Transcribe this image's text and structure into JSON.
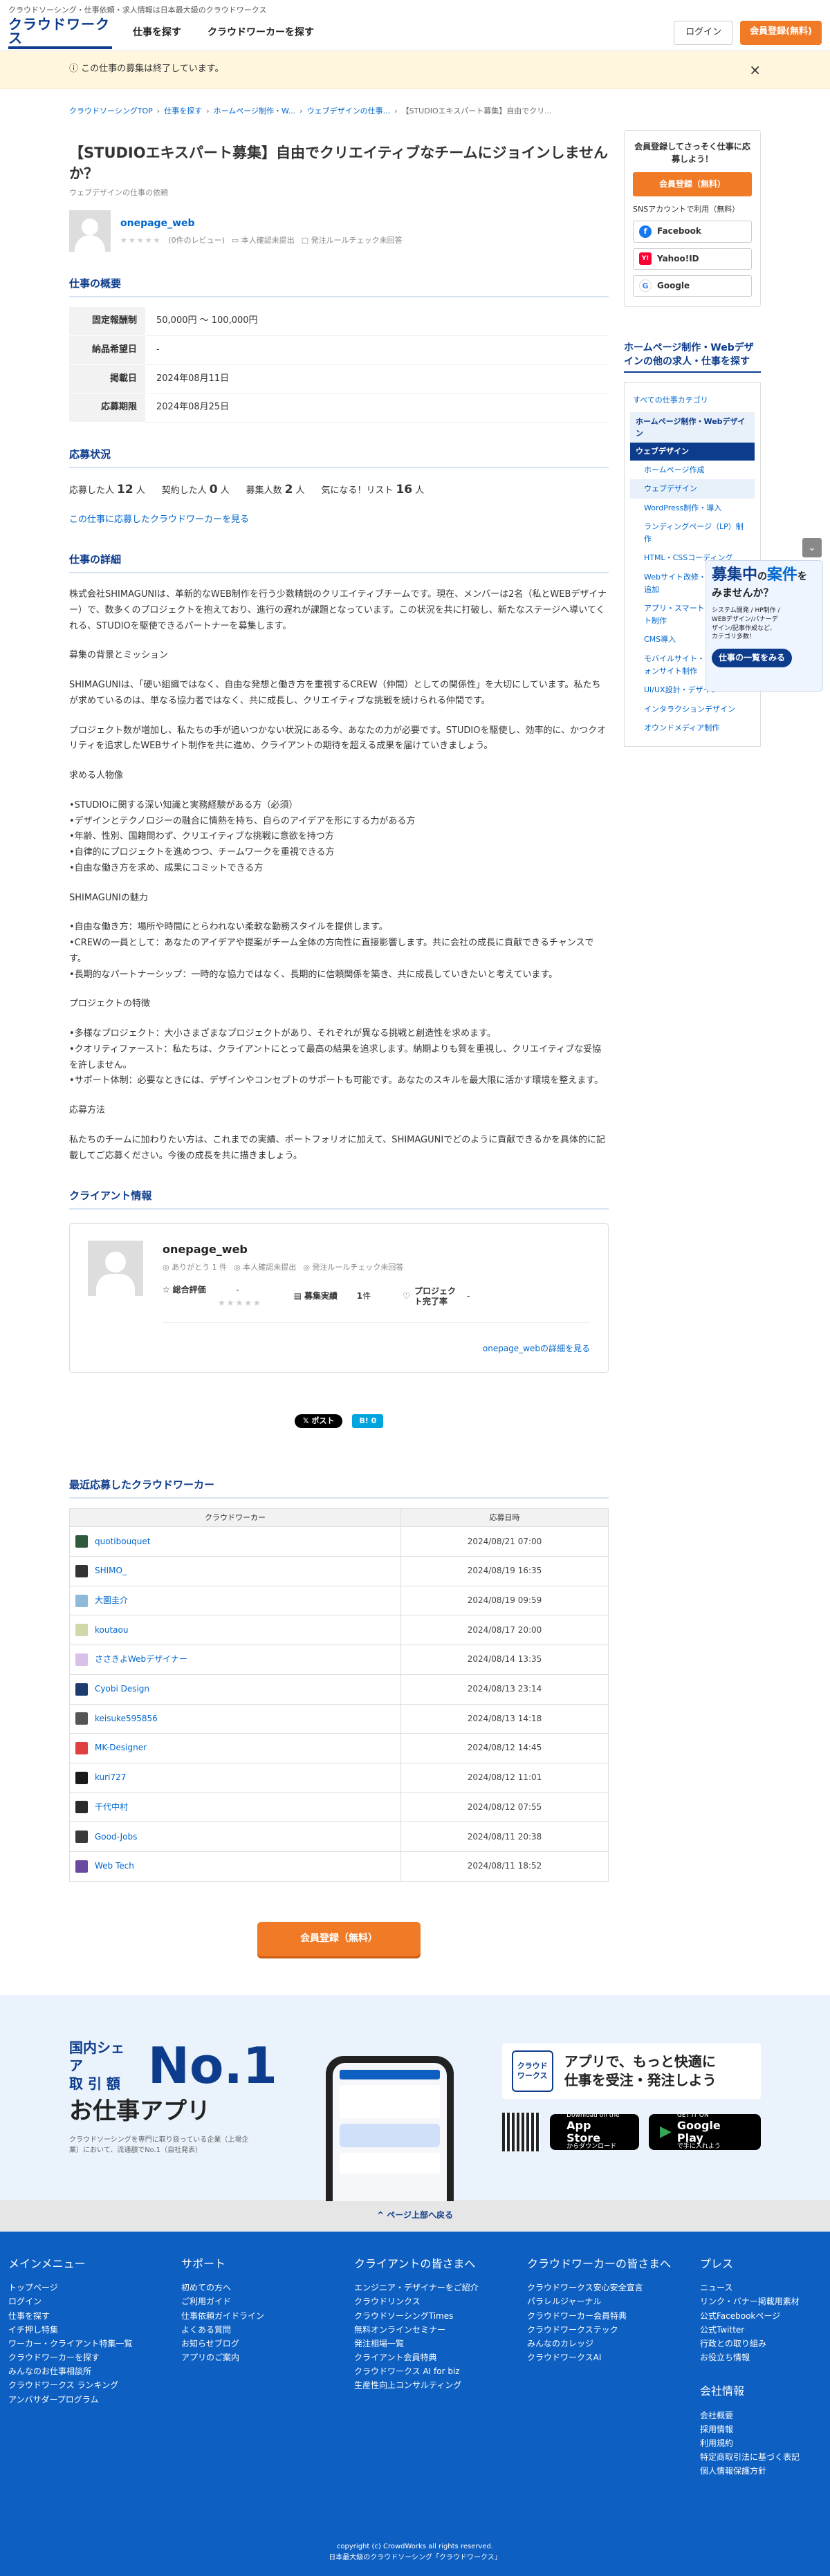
{
  "tagline": "クラウドソーシング・仕事依頼・求人情報は日本最大級のクラウドワークス",
  "header": {
    "logo_text": "クラウドワークス",
    "nav": [
      "仕事を探す",
      "クラウドワーカーを探す"
    ],
    "login": "ログイン",
    "signup": "会員登録(無料)"
  },
  "notice": {
    "text": "この仕事の募集は終了しています。",
    "close": "×"
  },
  "breadcrumb": [
    "クラウドソーシングTOP",
    "仕事を探す",
    "ホームページ制作・W...",
    "ウェブデザインの仕事...",
    "【STUDIOエキスパート募集】自由でクリ..."
  ],
  "job": {
    "title": "【STUDIOエキスパート募集】自由でクリエイティブなチームにジョインしませんか？",
    "subtitle": "ウェブデザインの仕事の依頼",
    "client_name": "onepage_web",
    "stars": "★★★★★",
    "reviews": "(0件のレビュー)",
    "identity": "本人確認未提出",
    "rule_check": "発注ルールチェック未回答"
  },
  "summary": {
    "heading": "仕事の概要",
    "rows": [
      {
        "label": "固定報酬制",
        "value": "50,000円 〜 100,000円"
      },
      {
        "label": "納品希望日",
        "value": "-"
      },
      {
        "label": "掲載日",
        "value": "2024年08月11日"
      },
      {
        "label": "応募期限",
        "value": "2024年08月25日"
      }
    ]
  },
  "status": {
    "heading": "応募状況",
    "applicants_label": "応募した人",
    "applicants": "12",
    "contracted_label": "契約した人",
    "contracted": "0",
    "quota_label": "募集人数",
    "quota": "2",
    "watch_label": "気になる！リスト",
    "watch": "16",
    "unit_person": "人",
    "link": "この仕事に応募したクラウドワーカーを見る"
  },
  "detail": {
    "heading": "仕事の詳細",
    "paragraphs": [
      "株式会社SHIMAGUNIは、革新的なWEB制作を行う少数精鋭のクリエイティブチームです。現在、メンバーは2名（私とWEBデザイナー）で、数多くのプロジェクトを抱えており、進行の遅れが課題となっています。この状況を共に打破し、新たなステージへ導いてくれる、STUDIOを駆使できるパートナーを募集します。",
      "募集の背景とミッション",
      "SHIMAGUNIは、「硬い組織ではなく、自由な発想と働き方を重視するCREW（仲間）としての関係性」を大切にしています。私たちが求めているのは、単なる協力者ではなく、共に成長し、クリエイティブな挑戦を続けられる仲間です。",
      "プロジェクト数が増加し、私たちの手が追いつかない状況にある今、あなたの力が必要です。STUDIOを駆使し、効率的に、かつクオリティを追求したWEBサイト制作を共に進め、クライアントの期待を超える成果を届けていきましょう。",
      "求める人物像",
      "•STUDIOに関する深い知識と実務経験がある方（必須）\n•デザインとテクノロジーの融合に情熱を持ち、自らのアイデアを形にする力がある方\n•年齢、性別、国籍問わず、クリエイティブな挑戦に意欲を持つ方\n•自律的にプロジェクトを進めつつ、チームワークを重視できる方\n•自由な働き方を求め、成果にコミットできる方",
      "SHIMAGUNIの魅力",
      "•自由な働き方：場所や時間にとらわれない柔軟な勤務スタイルを提供します。\n•CREWの一員として：あなたのアイデアや提案がチーム全体の方向性に直接影響します。共に会社の成長に貢献できるチャンスです。\n•長期的なパートナーシップ：一時的な協力ではなく、長期的に信頼関係を築き、共に成長していきたいと考えています。",
      "プロジェクトの特徴",
      "•多様なプロジェクト：大小さまざまなプロジェクトがあり、それぞれが異なる挑戦と創造性を求めます。\n•クオリティファースト：私たちは、クライアントにとって最高の結果を追求します。納期よりも質を重視し、クリエイティブな妥協を許しません。\n•サポート体制：必要なときには、デザインやコンセプトのサポートも可能です。あなたのスキルを最大限に活かす環境を整えます。",
      "応募方法",
      "私たちのチームに加わりたい方は、これまでの実績、ポートフォリオに加えて、SHIMAGUNIでどのように貢献できるかを具体的に記載してご応募ください。今後の成長を共に描きましょう。"
    ]
  },
  "client_info": {
    "heading": "クライアント情報",
    "name": "onepage_web",
    "thanks": "ありがとう 1 件",
    "identity": "本人確認未提出",
    "rule_check": "発注ルールチェック未回答",
    "rating_label": "総合評価",
    "rating_value": "-",
    "stars": "★★★★★",
    "record_label": "募集実績",
    "record_value": "1",
    "record_unit": "件",
    "completion_label": "プロジェクト完了率",
    "completion_value": "-",
    "detail_link": "onepage_webの詳細を見る"
  },
  "share": {
    "x": "𝕏 ポスト",
    "hatena": "B! 0"
  },
  "workers": {
    "heading": "最近応募したクラウドワーカー",
    "col_worker": "クラウドワーカー",
    "col_date": "応募日時",
    "rows": [
      {
        "name": "quotibouquet",
        "date": "2024/08/21 07:00",
        "color": "#2e5a3e"
      },
      {
        "name": "SHIMO_",
        "date": "2024/08/19 16:35",
        "color": "#333333"
      },
      {
        "name": "大園圭介",
        "date": "2024/08/19 09:59",
        "color": "#8fb9d8"
      },
      {
        "name": "koutaou",
        "date": "2024/08/17 20:00",
        "color": "#cfd8a8"
      },
      {
        "name": "ささきよWebデザイナー",
        "date": "2024/08/14 13:35",
        "color": "#d8c0e8"
      },
      {
        "name": "Cyobi Design",
        "date": "2024/08/13 23:14",
        "color": "#1d3b6e"
      },
      {
        "name": "keisuke595856",
        "date": "2024/08/13 14:18",
        "color": "#555555"
      },
      {
        "name": "MK-Designer",
        "date": "2024/08/12 14:45",
        "color": "#e04040"
      },
      {
        "name": "kuri727",
        "date": "2024/08/12 11:01",
        "color": "#1a1a1a"
      },
      {
        "name": "千代中村",
        "date": "2024/08/12 07:55",
        "color": "#2a2a2a"
      },
      {
        "name": "Good-Jobs",
        "date": "2024/08/11 20:38",
        "color": "#3a3a3a"
      },
      {
        "name": "Web Tech",
        "date": "2024/08/11 18:52",
        "color": "#6a4aa0"
      }
    ]
  },
  "cta_bottom": "会員登録（無料）",
  "sidebar": {
    "lead": "会員登録してさっそく仕事に応募しよう！",
    "signup": "会員登録（無料）",
    "sns_label": "SNSアカウントで利用（無料）",
    "sns": [
      {
        "label": "Facebook",
        "icon": "f",
        "color": "#1877f2"
      },
      {
        "label": "Yahoo!ID",
        "icon": "Y!",
        "color": "#ff0033"
      },
      {
        "label": "Google",
        "icon": "G",
        "color": "#4285f4"
      }
    ],
    "related_title": "ホームページ制作・Webデザインの他の求人・仕事を探す",
    "all_categories": "すべての仕事カテゴリ",
    "cat_parent": "ホームページ制作・Webデザイン",
    "cat_active": "ウェブデザイン",
    "subcats": [
      "ホームページ作成",
      "ウェブデザイン",
      "WordPress制作・導入",
      "ランディングページ（LP）制作",
      "HTML・CSSコーディング",
      "Webサイト改修・更新・機能追加",
      "アプリ・スマートフォンサイト制作",
      "CMS導入",
      "モバイルサイト・スマートフォンサイト制作",
      "UI/UX設計・デザイン",
      "インタラクションデザイン",
      "オウンドメディア制作"
    ]
  },
  "float_banner": {
    "title1": "募集中",
    "title2": "の",
    "title3": "案件",
    "title4": "を",
    "question": "みませんか？",
    "desc": "システム開発 / HP制作 / WEBデザイン/バナーデザイン/記事作成など、カテゴリ多数！",
    "button": "仕事の一覧をみる",
    "toggle": "⌄"
  },
  "app_banner": {
    "line1": "国内シェア",
    "line2": "取 引 額",
    "no1": "No.1",
    "big": "お仕事アプリ",
    "note": "クラウドソーシングを専門に取り扱っている企業（上場企業）において、流通額でNo.1（自社発表）",
    "catch": "アプリで、もっと快適に\n仕事を受注・発注しよう",
    "logo_text": "クラウド\nワークス",
    "appstore_small": "Download on the",
    "appstore": "App Store",
    "appstore_sub": "からダウンロード",
    "gplay_small": "GET IT ON",
    "gplay": "Google Play",
    "gplay_sub": "で手に入れよう"
  },
  "back_top": "ページ上部へ戻る",
  "footer": {
    "cols": [
      {
        "title": "メインメニュー",
        "items": [
          "トップページ",
          "ログイン",
          "仕事を探す",
          "イチ押し特集",
          "ワーカー・クライアント特集一覧",
          "クラウドワーカーを探す",
          "みんなのお仕事相談所",
          "クラウドワークス ランキング",
          "アンバサダープログラム"
        ]
      },
      {
        "title": "サポート",
        "items": [
          "初めての方へ",
          "ご利用ガイド",
          "仕事依頼ガイドライン",
          "よくある質問",
          "お知らせブログ",
          "アプリのご案内"
        ]
      },
      {
        "title": "クライアントの皆さまへ",
        "items": [
          "エンジニア・デザイナーをご紹介",
          "クラウドリンクス",
          "クラウドソーシングTimes",
          "無料オンラインセミナー",
          "発注相場一覧",
          "クライアント会員特典",
          "クラウドワークス AI for biz",
          "生産性向上コンサルティング"
        ]
      },
      {
        "title": "クラウドワーカーの皆さまへ",
        "items": [
          "クラウドワークス安心安全宣言",
          "パラレルジャーナル",
          "クラウドワーカー会員特典",
          "クラウドワークステック",
          "みんなのカレッジ",
          "クラウドワークスAI"
        ]
      },
      {
        "title": "プレス",
        "items": [
          "ニュース",
          "リンク・バナー掲載用素材",
          "公式Facebookページ",
          "公式Twitter",
          "行政との取り組み",
          "お役立ち情報"
        ]
      }
    ],
    "company_title": "会社情報",
    "company_items": [
      "会社概要",
      "採用情報",
      "利用規約",
      "特定商取引法に基づく表記",
      "個人情報保護方針"
    ],
    "copyright": "copyright (c) CrowdWorks all rights reserved.",
    "copyright2": "日本最大級のクラウドソーシング「クラウドワークス」"
  }
}
